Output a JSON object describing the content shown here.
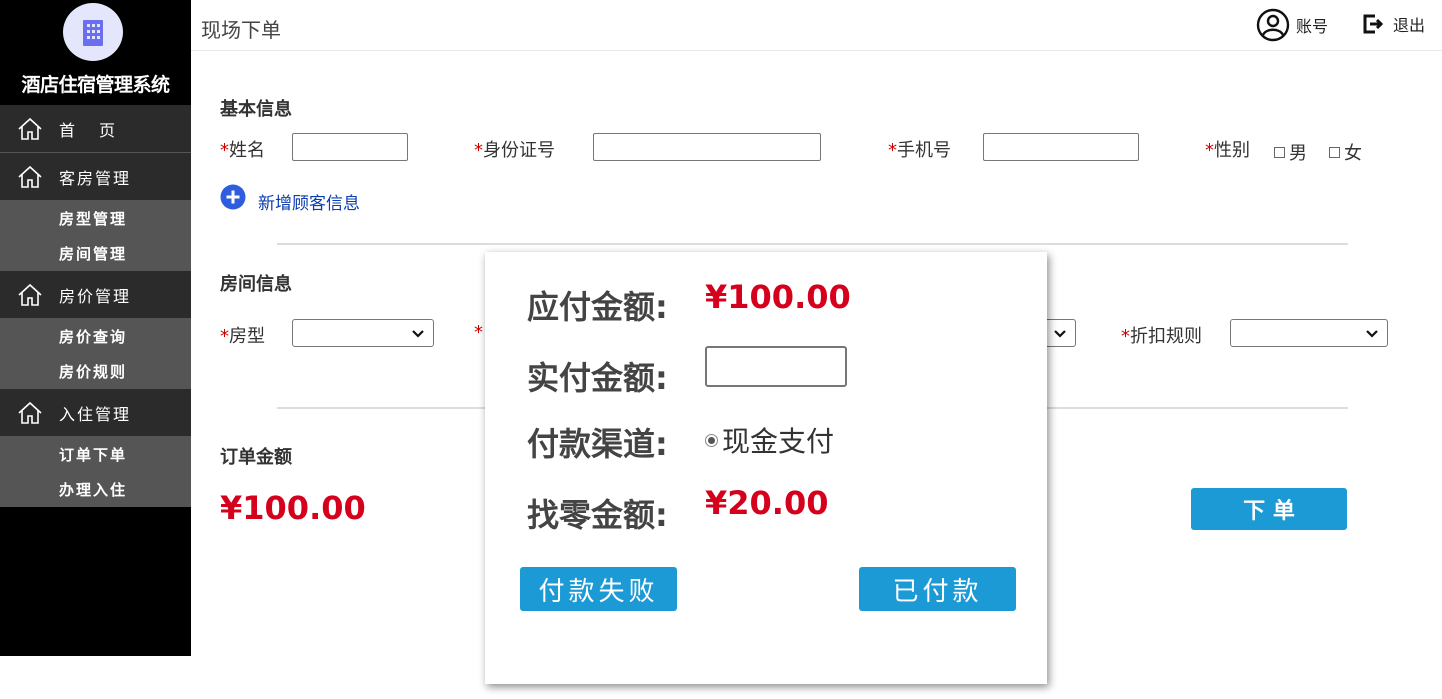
{
  "sidebar": {
    "app_title": "酒店住宿管理系统",
    "home_label": "首页",
    "groups": [
      {
        "label": "客房管理",
        "items": [
          "房型管理",
          "房间管理"
        ]
      },
      {
        "label": "房价管理",
        "items": [
          "房价查询",
          "房价规则"
        ]
      },
      {
        "label": "入住管理",
        "items": [
          "订单下单",
          "办理入住"
        ]
      }
    ]
  },
  "header": {
    "page_title": "现场下单",
    "account_label": "账号",
    "logout_label": "退出"
  },
  "basic_info": {
    "title": "基本信息",
    "required_mark": "*",
    "name_label": "姓名",
    "id_label": "身份证号",
    "phone_label": "手机号",
    "gender_label": "性别",
    "gender_male": "男",
    "gender_female": "女",
    "add_customer": "新增顾客信息"
  },
  "room_info": {
    "title": "房间信息",
    "room_type_label": "房型",
    "discount_label": "折扣规则"
  },
  "order": {
    "title": "订单金额",
    "amount": "¥100.00",
    "submit_label": "下 单"
  },
  "modal": {
    "payable_label": "应付金额:",
    "payable_value": "¥100.00",
    "paid_label": "实付金额:",
    "channel_label": "付款渠道:",
    "channel_option": "现金支付",
    "change_label": "找零金额:",
    "change_value": "¥20.00",
    "fail_button": "付款失败",
    "paid_button": "已付款"
  },
  "colors": {
    "accent": "#1b9ad6",
    "price": "#d4001c",
    "sidebar_bg": "#000000",
    "sidebar_sub": "#555555"
  }
}
